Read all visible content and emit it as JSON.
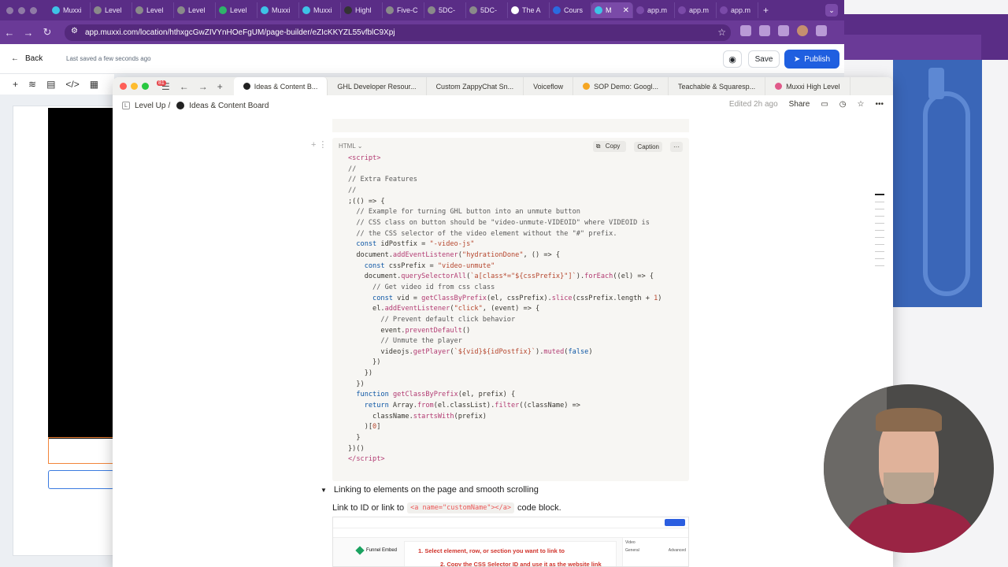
{
  "chrome": {
    "tabs": [
      {
        "label": "Muxxi",
        "color": "#3ec3e6"
      },
      {
        "label": "Level",
        "color": "#8a8a8a"
      },
      {
        "label": "Level",
        "color": "#8a8a8a"
      },
      {
        "label": "Level",
        "color": "#8a8a8a"
      },
      {
        "label": "Level",
        "color": "#2fb36a"
      },
      {
        "label": "Muxxi",
        "color": "#3ec3e6"
      },
      {
        "label": "Muxxi",
        "color": "#3ec3e6"
      },
      {
        "label": "Highl",
        "color": "#333333"
      },
      {
        "label": "Five-C",
        "color": "#8a8a8a"
      },
      {
        "label": "5DC-",
        "color": "#8a8a8a"
      },
      {
        "label": "5DC-",
        "color": "#8a8a8a"
      },
      {
        "label": "The A",
        "color": "#ffffff"
      },
      {
        "label": "Cours",
        "color": "#2a6be0"
      },
      {
        "label": "M",
        "color": "#3ec3e6"
      },
      {
        "label": "app.m",
        "color": "#7a4aa8"
      },
      {
        "label": "app.m",
        "color": "#7a4aa8"
      },
      {
        "label": "app.m",
        "color": "#7a4aa8"
      }
    ],
    "active_tab_index": 13,
    "url": "app.muxxi.com/location/hthxgcGwZIVYnHOeFgUM/page-builder/eZIcKKYZL55vfblC9Xpj"
  },
  "builder": {
    "back_label": "Back",
    "saved_text": "Last saved a few seconds ago",
    "save_label": "Save",
    "publish_label": "Publish"
  },
  "notion": {
    "badge": "81",
    "tabs": [
      {
        "label": "Ideas & Content B...",
        "color": "#222222"
      },
      {
        "label": "GHL Developer Resour...",
        "color": ""
      },
      {
        "label": "Custom ZappyChat Sn...",
        "color": ""
      },
      {
        "label": "Voiceflow",
        "color": ""
      },
      {
        "label": "SOP Demo: Googl...",
        "color": "#f5a623"
      },
      {
        "label": "Teachable & Squaresp...",
        "color": ""
      },
      {
        "label": "Muxxi High Level",
        "color": "#e05a8a"
      }
    ],
    "breadcrumb_root_initial": "L",
    "breadcrumb_root": "Level Up",
    "breadcrumb_sep": "/",
    "breadcrumb_page": "Ideas & Content Board",
    "edited": "Edited 2h ago",
    "share_label": "Share",
    "code_block": {
      "language": "HTML",
      "copy_label": "Copy",
      "caption_label": "Caption"
    },
    "toggle_heading": "Linking to elements on the page and smooth scrolling",
    "link_text_before": "Link to ID or link to",
    "link_code": "<a name=\"customName\"></a>",
    "link_text_after": "code block.",
    "embed": {
      "brand": "Funnel Embed",
      "step1": "1. Select element, row, or section you want to link to",
      "step2": "2. Copy the CSS Selector ID and use it as the website link",
      "side_title": "Video",
      "side_tab1": "General",
      "side_tab2": "Advanced"
    }
  }
}
